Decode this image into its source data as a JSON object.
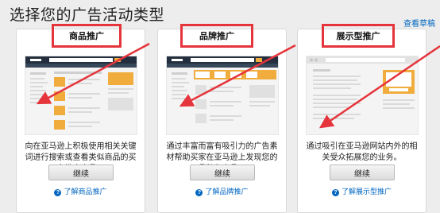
{
  "page": {
    "title": "选择您的广告活动类型",
    "drafts_link": "查看草稿"
  },
  "cards": [
    {
      "title": "商品推广",
      "description": "向在亚马逊上积极使用相关关键词进行搜索或查看类似商品的买家推广商品。",
      "button": "继续",
      "learn_more": "了解商品推广"
    },
    {
      "title": "品牌推广",
      "description": "通过丰富而富有吸引力的广告素材帮助买家在亚马逊上发现您的品牌和商品。",
      "button": "继续",
      "learn_more": "了解品牌推广"
    },
    {
      "title": "展示型推广",
      "description": "通过吸引在亚马逊网站内外的相关受众拓展您的业务。",
      "button": "继续",
      "learn_more": "了解展示型推广"
    }
  ],
  "colors": {
    "highlight_red": "#e5343b",
    "amazon_orange": "#f0ad3e",
    "link_blue": "#0066c0"
  }
}
